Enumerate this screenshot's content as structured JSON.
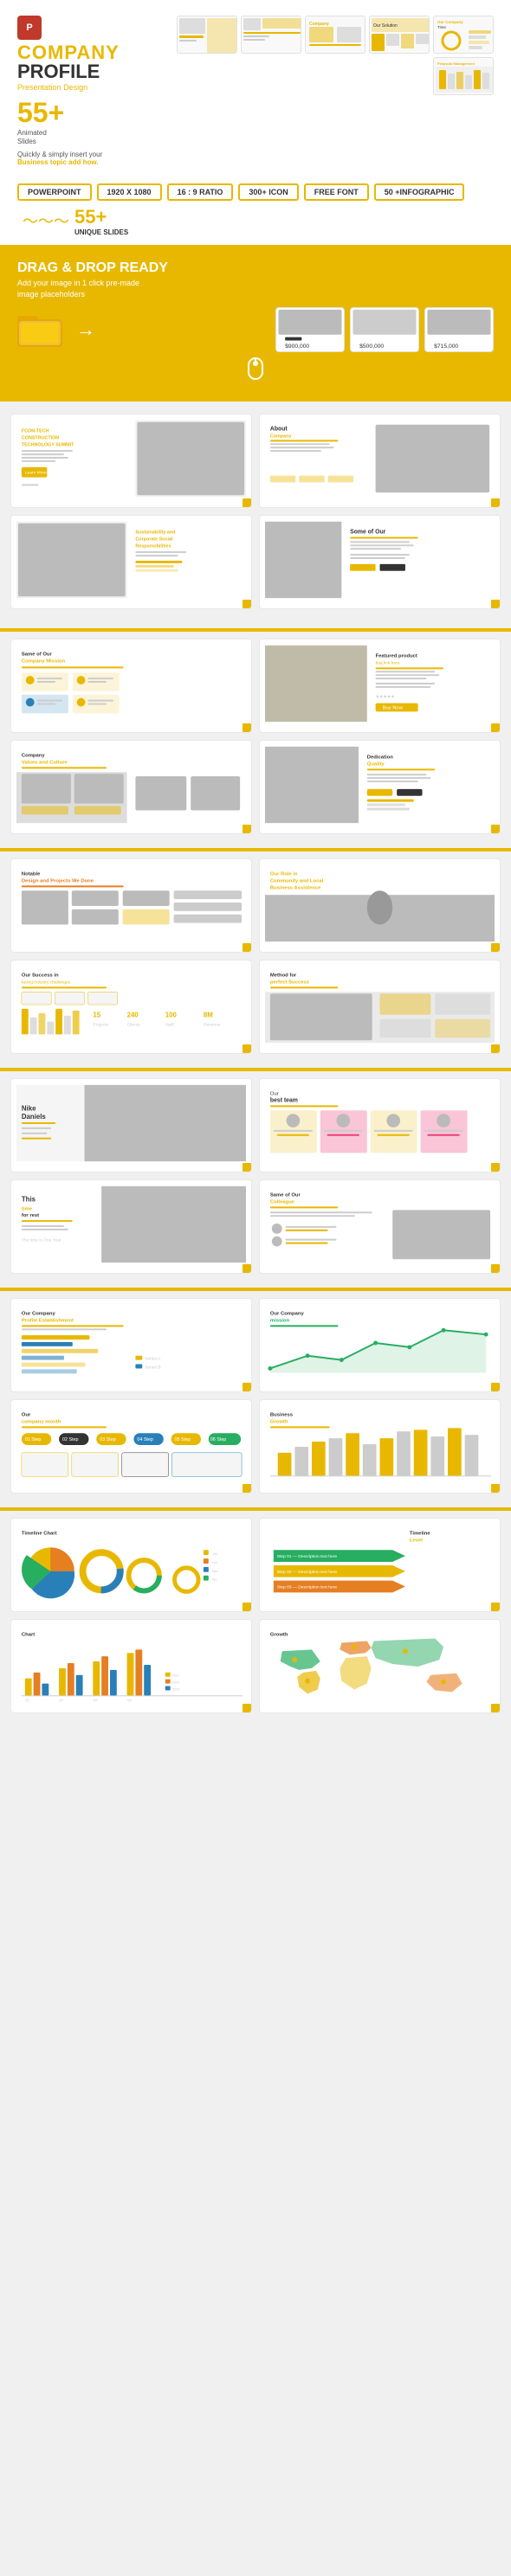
{
  "header": {
    "ppt_icon": "P",
    "company_label": "COMPANY",
    "profile_label": "PROFILE",
    "presentation_label": "Presentation",
    "design_label": "Design",
    "slides_count": "55+",
    "animated_label": "Animated",
    "slides_label": "Slides",
    "quickly_label": "Quickly & simply insert your",
    "business_label": "Business topic add how."
  },
  "badges": [
    {
      "label": "POWERPOINT",
      "highlight": false
    },
    {
      "label": "1920 X 1080",
      "highlight": false
    },
    {
      "label": "16 : 9 RATIO",
      "highlight": false
    },
    {
      "label": "300+ ICON",
      "highlight": false
    },
    {
      "label": "FREE FONT",
      "highlight": false
    },
    {
      "label": "50 +INFOGRAPHIC",
      "highlight": false
    }
  ],
  "unique_slides": {
    "count": "55+",
    "label": "UNIQUE SLIDES"
  },
  "dragdrop": {
    "title": "DRAG & DROP READY",
    "subtitle": "Add your image in 1 click pre-made",
    "subtitle2": "image placeholders",
    "price1": "$900,000",
    "price2": "$500,000",
    "price3": "$715,000"
  },
  "slides": {
    "row1": [
      {
        "title": "FCON-TECH CONSTRUCTION TECHNOLOGY SUMMIT",
        "has_image": true,
        "has_button": true,
        "button_color": "#e8b800"
      },
      {
        "title": "About",
        "subtitle": "Company",
        "has_image": true,
        "has_bars": true
      }
    ],
    "row2": [
      {
        "title": "Sustainability and Corporate Social Responsibilities",
        "has_image": true,
        "has_bars": true
      },
      {
        "title": "Some of Our",
        "has_image": true,
        "has_bars": true
      }
    ],
    "row3": [
      {
        "title": "Same of Our Company Mission",
        "has_icon_boxes": true,
        "color": "#e8b800"
      },
      {
        "title": "Featured product",
        "subtitle": "that link here",
        "has_image": true,
        "color": "#e8b800"
      }
    ],
    "row4": [
      {
        "title": "Company Values and Culture",
        "has_image": true,
        "color": "#333"
      },
      {
        "title": "Dedication Quality",
        "has_image": true,
        "color": "#e8b800"
      }
    ],
    "row5": [
      {
        "title": "Notable Design and Projects We Done",
        "has_image": true,
        "color": "#e67e22"
      },
      {
        "title": "Our Role in Community and Local Business Assistence",
        "has_image": true,
        "color": "#e8b800"
      }
    ],
    "row6": [
      {
        "title": "Our Success in facing industry challenges",
        "has_bars": true,
        "color": "#e8b800"
      },
      {
        "title": "Method for perfect Success",
        "has_image": true,
        "color": "#333"
      }
    ],
    "row7": [
      {
        "title": "Nike Daniels",
        "has_image": true,
        "color": "#333"
      },
      {
        "title": "Our best team",
        "has_image": true,
        "color": "#333"
      }
    ],
    "row8": [
      {
        "title": "This time for test The time is One Year",
        "has_image": true,
        "color": "#e8b800"
      },
      {
        "title": "Same of Our",
        "subtitle": "Colleague",
        "has_image": true,
        "color": "#333"
      }
    ],
    "row9": [
      {
        "title": "Our Company Profile Establishment",
        "has_bars": true,
        "color": "#333"
      },
      {
        "title": "Our Company mission",
        "has_chart": true,
        "color": "#27ae60"
      }
    ],
    "row10": [
      {
        "title": "Our company month",
        "has_infographic": true,
        "color": "#e8b800"
      },
      {
        "title": "Business Growth",
        "has_bars": true,
        "color": "#e8b800"
      }
    ],
    "row11": [
      {
        "title": "Timeline Chart",
        "has_pie": true,
        "color": "#e8b800"
      },
      {
        "title": "Timeline Level",
        "has_arrows": true,
        "color": "#e8b800"
      }
    ],
    "row12": [
      {
        "title": "Chart",
        "has_bars2": true,
        "color": "#e8b800"
      },
      {
        "title": "Growth",
        "has_world_map": true,
        "color": "#27ae60"
      }
    ]
  }
}
